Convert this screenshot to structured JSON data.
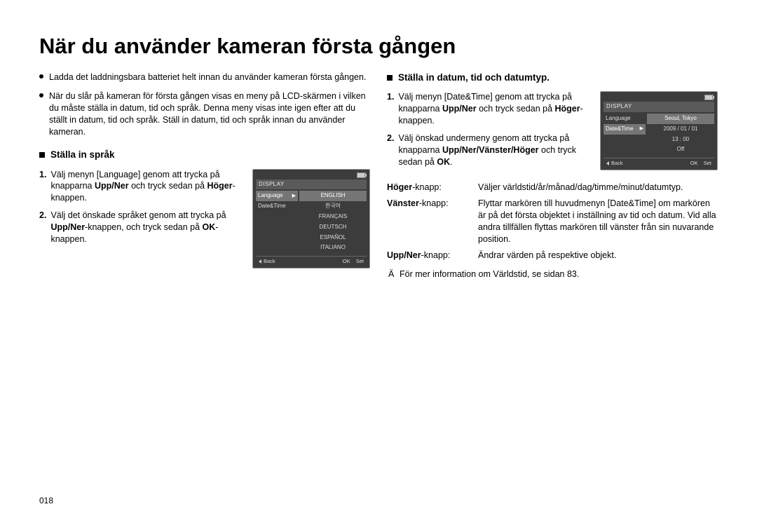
{
  "title": "När du använder kameran första gången",
  "intro_bullets": [
    "Ladda det laddningsbara batteriet helt innan du använder kameran första gången.",
    "När du slår på kameran för första gången visas en meny på LCD-skärmen i vilken du måste ställa in datum, tid och språk. Denna meny visas inte igen efter att du ställt in datum, tid och språk. Ställ in datum, tid och språk innan du använder kameran."
  ],
  "lang": {
    "heading": "Ställa in språk",
    "steps": [
      {
        "n": "1.",
        "pre": "Välj menyn [Language] genom att trycka på knapparna ",
        "b1": "Upp/Ner",
        "mid": " och tryck sedan på ",
        "b2": "Höger",
        "post": "-knappen."
      },
      {
        "n": "2.",
        "pre": "Välj det önskade språket genom att trycka på ",
        "b1": "Upp/Ner",
        "mid": "-knappen, och tryck sedan på ",
        "b2": "OK",
        "post": "-knappen."
      }
    ],
    "lcd": {
      "header": "DISPLAY",
      "left": [
        {
          "label": "Language",
          "sel": true
        },
        {
          "label": "Date&Time",
          "sel": false
        }
      ],
      "right": [
        "ENGLISH",
        "한국어",
        "FRANÇAIS",
        "DEUTSCH",
        "ESPAÑOL",
        "ITALIANO"
      ],
      "right_sel": 0,
      "foot_back": "Back",
      "foot_ok": "OK",
      "foot_set": "Set"
    }
  },
  "dt": {
    "heading": "Ställa in datum, tid och datumtyp.",
    "steps": [
      {
        "n": "1.",
        "pre": "Välj menyn [Date&Time] genom att trycka på knapparna ",
        "b1": "Upp/Ner",
        "mid": " och tryck sedan på ",
        "b2": "Höger",
        "post": "-knappen."
      },
      {
        "n": "2.",
        "pre": "Välj önskad undermeny genom att trycka på knapparna ",
        "b1": "Upp/Ner/Vänster/Höger",
        "mid": " och tryck sedan på ",
        "b2": "OK",
        "post": "."
      }
    ],
    "lcd": {
      "header": "DISPLAY",
      "left": [
        {
          "label": "Language",
          "sel": false
        },
        {
          "label": "Date&Time",
          "sel": true
        }
      ],
      "right": [
        "Seoul, Tokyo",
        "2009 / 01 / 01",
        "13 : 00",
        "Off"
      ],
      "right_sel": 0,
      "foot_back": "Back",
      "foot_ok": "OK",
      "foot_set": "Set"
    },
    "table": [
      {
        "k": "Höger",
        "ks": "-knapp:",
        "v": "Väljer världstid/år/månad/dag/timme/minut/datumtyp."
      },
      {
        "k": "Vänster",
        "ks": "-knapp:",
        "v": "Flyttar markören till huvudmenyn [Date&Time] om markören är på det första objektet i inställning av tid och datum. Vid alla andra tillfällen flyttas markören till vänster från sin nuvarande position."
      },
      {
        "k": "Upp/Ner",
        "ks": "-knapp:",
        "v": "Ändrar värden på respektive objekt."
      }
    ],
    "note_mark": "Ä",
    "note": "För mer information om Världstid, se sidan 83."
  },
  "page_number": "018"
}
